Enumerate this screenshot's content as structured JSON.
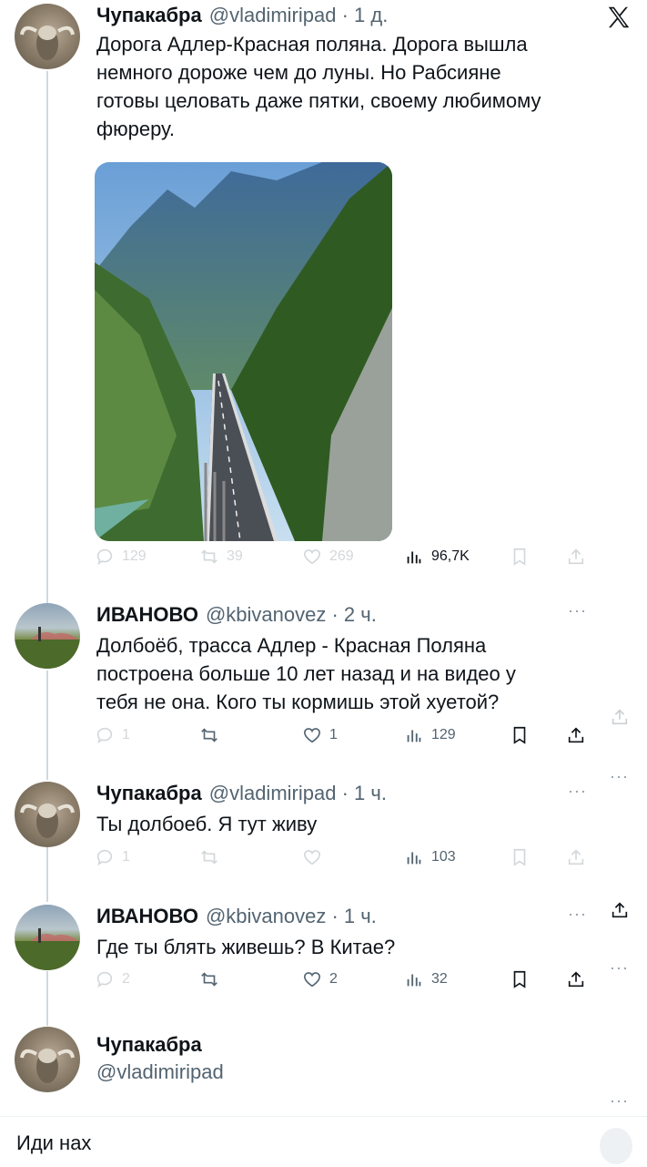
{
  "tweet_main": {
    "name": "Чупакабра",
    "handle": "@vladimiripad",
    "time": "1 д.",
    "text_lines": [
      "Дорога Адлер-Красная поляна. Дорога вышла",
      "немного дороже чем до луны. Но Рабсияне",
      "готовы целовать даже пятки, своему любимому",
      "фюреру."
    ],
    "stats": {
      "replies": "129",
      "reposts": "39",
      "likes": "269",
      "views": "96,7K"
    }
  },
  "reply_1": {
    "name": "ИВАНОВО",
    "handle": "@kbivanovez",
    "time": "2 ч.",
    "text_lines": [
      "Долбоёб, трасса Адлер - Красная Поляна",
      "построена больше 10 лет назад и на видео у",
      "тебя не она. Кого ты кормишь этой хуетой?"
    ],
    "stats": {
      "replies": "1",
      "reposts": "",
      "likes": "1",
      "views": "129"
    }
  },
  "reply_2": {
    "name": "Чупакабра",
    "handle": "@vladimiripad",
    "time": "1 ч.",
    "text_lines": [
      "Ты долбоеб. Я тут живу"
    ],
    "stats": {
      "replies": "1",
      "reposts": "",
      "likes": "",
      "views": "103"
    }
  },
  "reply_3": {
    "name": "ИВАНОВО",
    "handle": "@kbivanovez",
    "time": "1 ч.",
    "text_lines": [
      "Где ты блять живешь? В Китае?"
    ],
    "stats": {
      "replies": "2",
      "reposts": "",
      "likes": "2",
      "views": "32"
    }
  },
  "compose": {
    "name": "Чупакабра",
    "handle": "@vladimiripad",
    "reply_text": "Иди нах"
  },
  "icons": {
    "x_logo": "x-logo-icon",
    "reply": "reply-icon",
    "repost": "repost-icon",
    "like": "heart-icon",
    "views": "views-icon",
    "bookmark": "bookmark-icon",
    "share": "share-icon",
    "more": "more-icon"
  },
  "colors": {
    "text": "#0f1419",
    "secondary": "#536471",
    "thread_line": "#cfd9de",
    "background": "#ffffff"
  }
}
